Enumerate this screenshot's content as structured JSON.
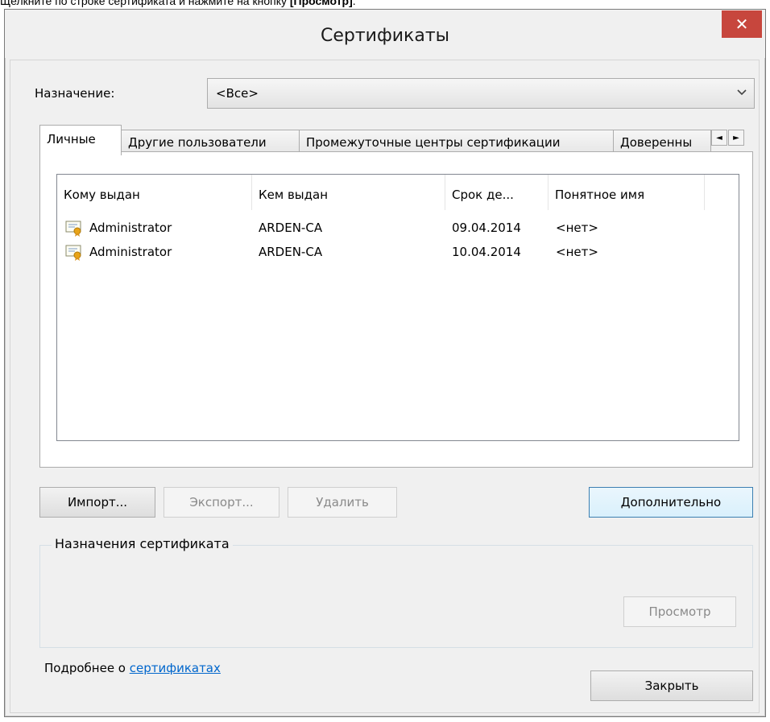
{
  "caption": {
    "text": "Щелкните по строке сертификата и нажмите на кнопку ",
    "bold": "[Просмотр]",
    "tail": "."
  },
  "window": {
    "title": "Сертификаты",
    "close_glyph": "✕"
  },
  "purpose": {
    "label": "Назначение:",
    "value": "<Все>"
  },
  "tabs": [
    {
      "label": "Личные",
      "active": true
    },
    {
      "label": "Другие пользователи",
      "active": false
    },
    {
      "label": "Промежуточные центры сертификации",
      "active": false
    },
    {
      "label": "Доверенны",
      "active": false
    }
  ],
  "tab_scroll": {
    "left": "◄",
    "right": "►"
  },
  "list": {
    "columns": [
      "Кому выдан",
      "Кем выдан",
      "Срок де...",
      "Понятное имя"
    ],
    "rows": [
      {
        "issued_to": "Administrator",
        "issued_by": "ARDEN-CA",
        "expires": "09.04.2014",
        "friendly": "<нет>"
      },
      {
        "issued_to": "Administrator",
        "issued_by": "ARDEN-CA",
        "expires": "10.04.2014",
        "friendly": "<нет>"
      }
    ]
  },
  "buttons": {
    "import": "Импорт...",
    "export": "Экспорт...",
    "remove": "Удалить",
    "advanced": "Дополнительно",
    "view": "Просмотр",
    "close": "Закрыть"
  },
  "group": {
    "legend": "Назначения сертификата"
  },
  "footer": {
    "prefix": "Подробнее о ",
    "link": "сертификатах"
  },
  "colors": {
    "close_button": "#c7463d",
    "link": "#0066cc"
  }
}
